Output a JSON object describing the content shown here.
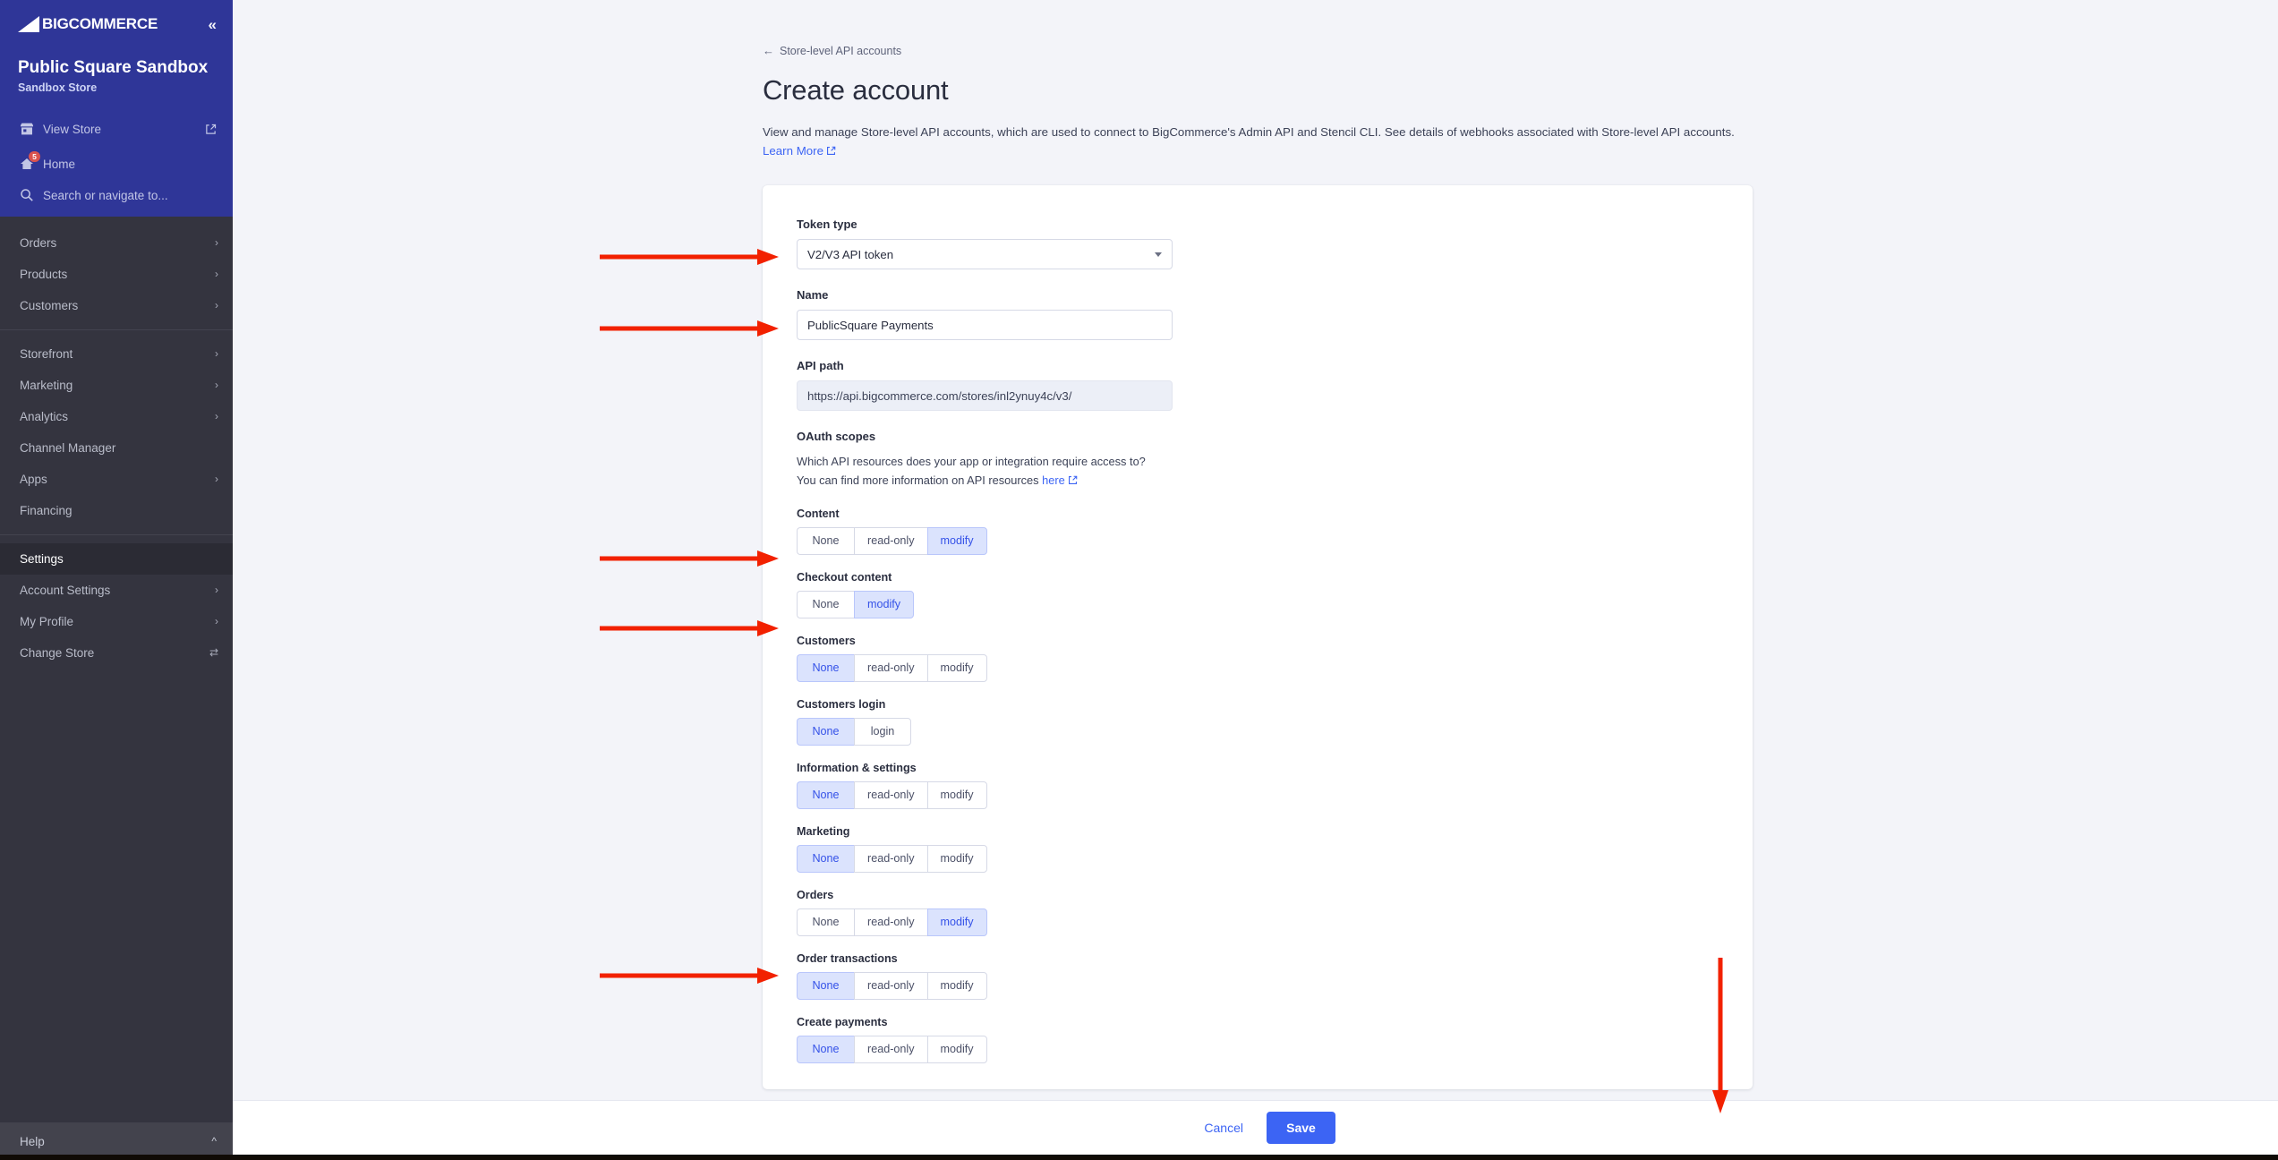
{
  "sidebar": {
    "brand": "BIGCOMMERCE",
    "collapse_label": "«",
    "store_name": "Public Square Sandbox",
    "store_type": "Sandbox Store",
    "quick_links": [
      {
        "label": "View Store",
        "icon": "store-icon",
        "external": true
      },
      {
        "label": "Home",
        "icon": "home-icon",
        "badge": "5"
      },
      {
        "label": "Search or navigate to...",
        "icon": "search-icon"
      }
    ],
    "nav_primary": [
      {
        "label": "Orders",
        "chevron": true
      },
      {
        "label": "Products",
        "chevron": true
      },
      {
        "label": "Customers",
        "chevron": true
      }
    ],
    "nav_secondary": [
      {
        "label": "Storefront",
        "chevron": true
      },
      {
        "label": "Marketing",
        "chevron": true
      },
      {
        "label": "Analytics",
        "chevron": true
      },
      {
        "label": "Channel Manager",
        "chevron": false
      },
      {
        "label": "Apps",
        "chevron": true
      },
      {
        "label": "Financing",
        "chevron": false
      }
    ],
    "nav_settings": [
      {
        "label": "Settings",
        "chevron": false,
        "active": true
      },
      {
        "label": "Account Settings",
        "chevron": true
      },
      {
        "label": "My Profile",
        "chevron": true
      },
      {
        "label": "Change Store",
        "chevron": false,
        "icon": "switch-icon"
      }
    ],
    "help": {
      "label": "Help",
      "chevron": "^"
    }
  },
  "main": {
    "breadcrumb": "Store-level API accounts",
    "title": "Create account",
    "description": "View and manage Store-level API accounts, which are used to connect to BigCommerce's Admin API and Stencil CLI. See details of webhooks associated with Store-level API accounts.",
    "learn_more": "Learn More",
    "form": {
      "token_type": {
        "label": "Token type",
        "value": "V2/V3 API token"
      },
      "name": {
        "label": "Name",
        "value": "PublicSquare Payments"
      },
      "api_path": {
        "label": "API path",
        "value": "https://api.bigcommerce.com/stores/inl2ynuy4c/v3/"
      }
    },
    "scopes": {
      "title": "OAuth scopes",
      "desc_line1": "Which API resources does your app or integration require access to?",
      "desc_line2_prefix": "You can find more information on API resources ",
      "desc_link": "here",
      "groups": [
        {
          "label": "Content",
          "options": [
            "None",
            "read-only",
            "modify"
          ],
          "selected": "modify"
        },
        {
          "label": "Checkout content",
          "options": [
            "None",
            "modify"
          ],
          "selected": "modify"
        },
        {
          "label": "Customers",
          "options": [
            "None",
            "read-only",
            "modify"
          ],
          "selected": "None"
        },
        {
          "label": "Customers login",
          "options": [
            "None",
            "login"
          ],
          "selected": "None"
        },
        {
          "label": "Information & settings",
          "options": [
            "None",
            "read-only",
            "modify"
          ],
          "selected": "None"
        },
        {
          "label": "Marketing",
          "options": [
            "None",
            "read-only",
            "modify"
          ],
          "selected": "None"
        },
        {
          "label": "Orders",
          "options": [
            "None",
            "read-only",
            "modify"
          ],
          "selected": "modify"
        },
        {
          "label": "Order transactions",
          "options": [
            "None",
            "read-only",
            "modify"
          ],
          "selected": "None"
        },
        {
          "label": "Create payments",
          "options": [
            "None",
            "read-only",
            "modify"
          ],
          "selected": "None"
        }
      ]
    },
    "footer": {
      "cancel": "Cancel",
      "save": "Save"
    }
  },
  "colors": {
    "brand_blue": "#2f3698",
    "accent_blue": "#3c64f4",
    "segment_on_bg": "#dbe3fd",
    "segment_on_text": "#3552e8",
    "annotation_red": "#f22100",
    "sidebar_dark": "#34343f",
    "page_bg": "#f3f4f9"
  }
}
